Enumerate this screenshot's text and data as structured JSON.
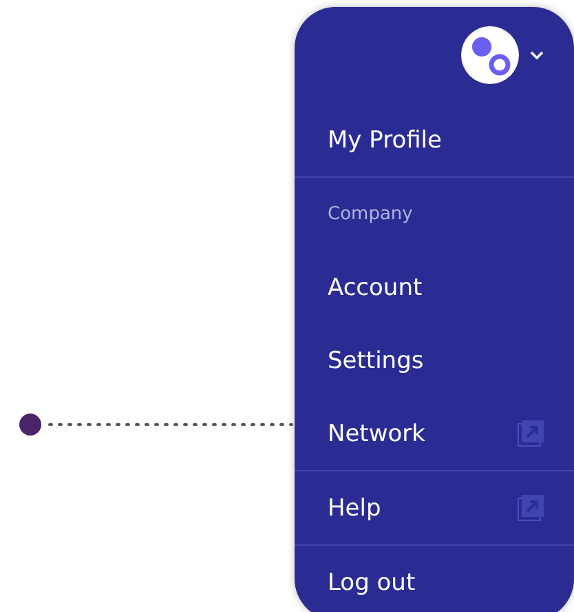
{
  "menu": {
    "sections": [
      {
        "items": [
          {
            "kind": "link",
            "label": "My Profile",
            "external": false
          }
        ]
      },
      {
        "items": [
          {
            "kind": "heading",
            "label": "Company"
          },
          {
            "kind": "link",
            "label": "Account",
            "external": false
          },
          {
            "kind": "link",
            "label": "Settings",
            "external": false
          },
          {
            "kind": "link",
            "label": "Network",
            "external": true
          }
        ]
      },
      {
        "items": [
          {
            "kind": "link",
            "label": "Help",
            "external": true
          }
        ]
      },
      {
        "items": [
          {
            "kind": "link",
            "label": "Log out",
            "external": false
          }
        ]
      }
    ]
  }
}
